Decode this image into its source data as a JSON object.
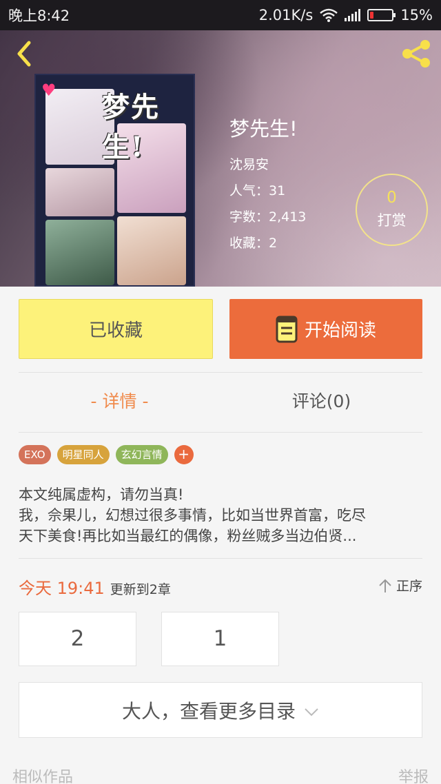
{
  "status_bar": {
    "time": "晚上8:42",
    "speed": "2.01K/s",
    "battery": "15%",
    "battery_level": 0.15
  },
  "book": {
    "cover_title": "梦先生!",
    "title": "梦先生!",
    "author": "沈易安",
    "popularity": "人气：31",
    "word_count": "字数：2,413",
    "favorites": "收藏：2"
  },
  "reward": {
    "count": "0",
    "label": "打赏"
  },
  "actions": {
    "favorited_label": "已收藏",
    "read_label": "开始阅读"
  },
  "tabs": {
    "detail": "- 详情 -",
    "comments": "评论(0)"
  },
  "tags": [
    {
      "label": "EXO",
      "color": "#d4735a"
    },
    {
      "label": "明星同人",
      "color": "#d7a33c"
    },
    {
      "label": "玄幻言情",
      "color": "#8fb65a"
    }
  ],
  "tag_add": "+",
  "description": {
    "line1": "本文纯属虚构，请勿当真!",
    "line2": "我，佘果儿，幻想过很多事情，比如当世界首富，吃尽",
    "line3": "天下美食!再比如当最红的偶像，粉丝贼多当边伯贤..."
  },
  "update": {
    "time": "今天 19:41",
    "text": "更新到2章",
    "order": "正序"
  },
  "chapters": [
    "2",
    "1"
  ],
  "more_catalog": "大人，查看更多目录",
  "footer": {
    "similar": "相似作品",
    "report": "举报"
  },
  "colors": {
    "accent": "#ec6c3c",
    "favorite_bg": "#fdf27a",
    "reward_ring": "#f3e38a",
    "icon_yellow": "#f8e04a"
  }
}
